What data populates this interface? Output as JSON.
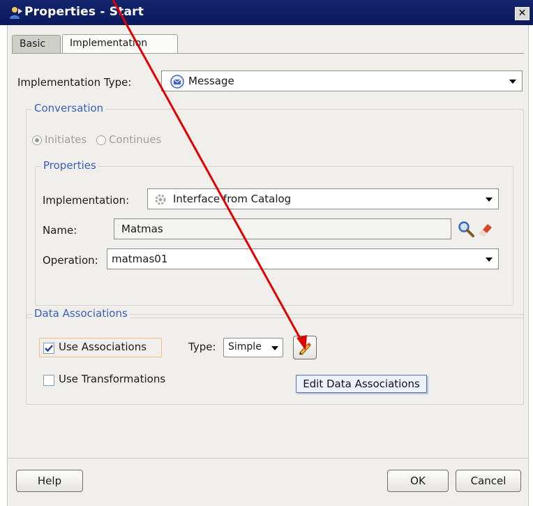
{
  "window": {
    "title": "Properties - Start",
    "close_glyph": "✕"
  },
  "tabs": [
    {
      "label": "Basic"
    },
    {
      "label": "Implementation"
    }
  ],
  "implementation_type": {
    "label": "Implementation Type:",
    "value": "Message"
  },
  "conversation": {
    "title": "Conversation",
    "options": [
      {
        "label": "Initiates",
        "selected": true
      },
      {
        "label": "Continues",
        "selected": false
      }
    ]
  },
  "properties": {
    "title": "Properties",
    "implementation": {
      "label": "Implementation:",
      "value": "Interface from Catalog"
    },
    "name": {
      "label": "Name:",
      "value": "Matmas"
    },
    "operation": {
      "label": "Operation:",
      "value": "matmas01"
    }
  },
  "data_associations": {
    "title": "Data Associations",
    "use_associations": {
      "label": "Use Associations",
      "checked": true
    },
    "type_label": "Type:",
    "type_value": "Simple",
    "use_transformations": {
      "label": "Use Transformations",
      "checked": false
    },
    "tooltip": "Edit Data Associations"
  },
  "buttons": {
    "help": "Help",
    "ok": "OK",
    "cancel": "Cancel"
  },
  "colors": {
    "titlebar": "#0a1a5c",
    "group_title": "#3a5fbf",
    "arrow": "#e00000"
  },
  "icons": [
    "person-icon",
    "message-icon",
    "gear-icon",
    "search-icon",
    "eraser-icon",
    "pencil-icon"
  ]
}
